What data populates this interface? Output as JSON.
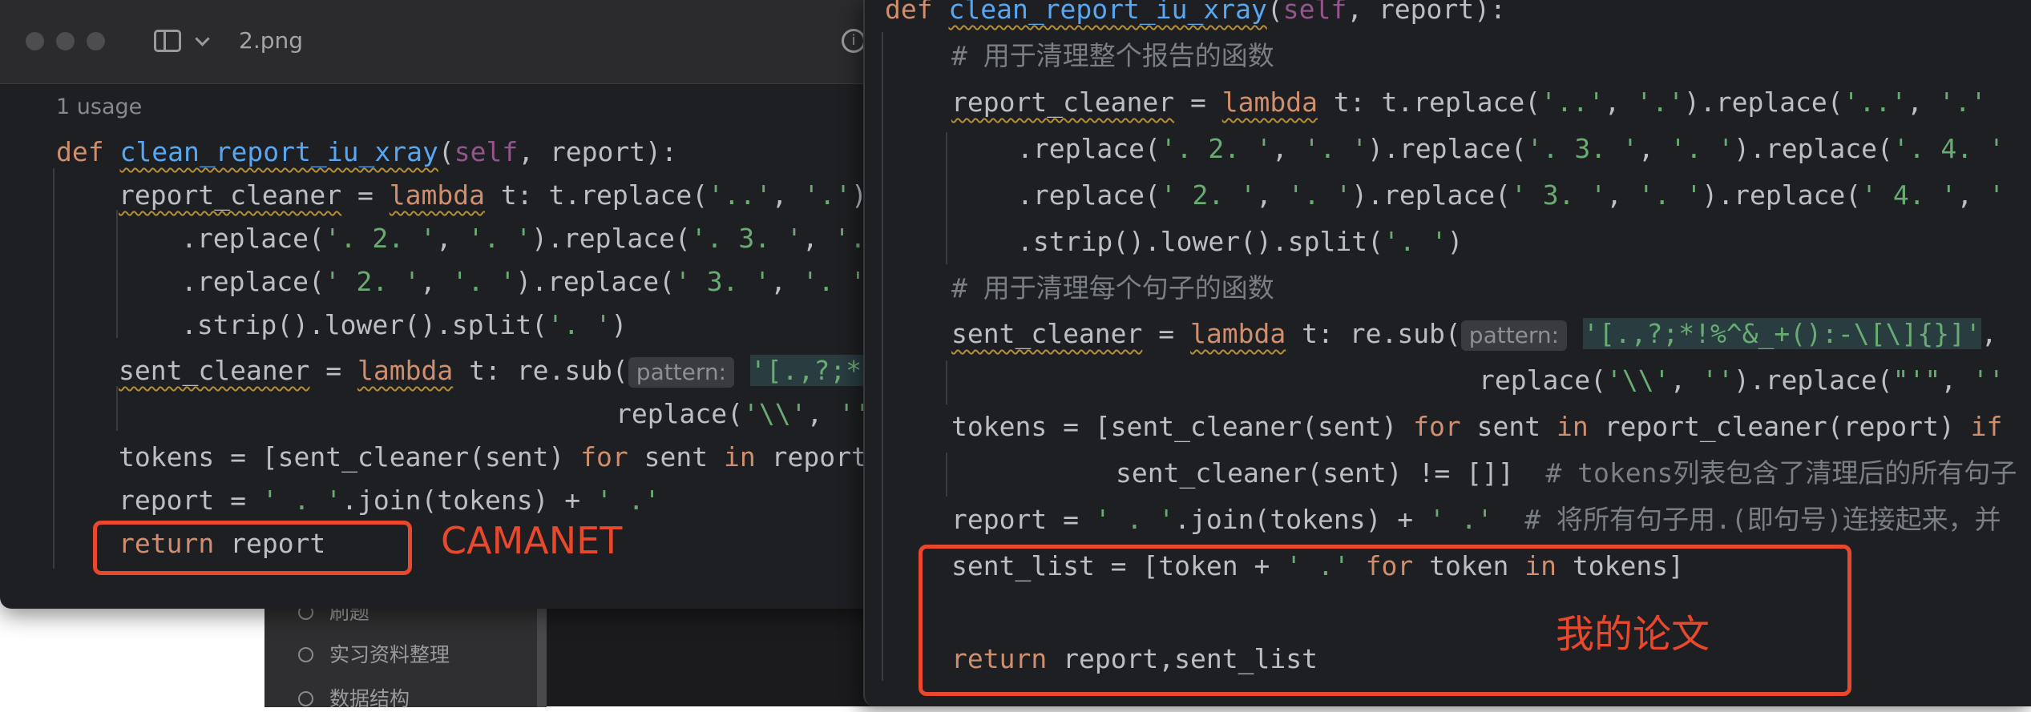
{
  "background_app": {
    "sidebar_items": [
      "刷题",
      "实习资料整理",
      "数据结构"
    ]
  },
  "left_window": {
    "title": "2.png",
    "usage": "1 usage",
    "code": {
      "def_kw": "def",
      "func_name": "clean_report_iu_xray",
      "paren_open": "(",
      "self_kw": "self",
      "sig_rest": ", report):",
      "l2_var": "report_cleaner",
      "l2_eq": " = ",
      "l2_lambda": "lambda",
      "l2_rest1": " t: t.replace(",
      "l2_s1": "'..'",
      "l2_comma": ", ",
      "l2_s2": "'.'",
      "l2_tail": ").",
      "l3_a": ".replace(",
      "l3_s1": "'. 2. '",
      "l3_c": ", ",
      "l3_s2": "'. '",
      "l3_b": ").replace(",
      "l3_s3": "'. 3. '",
      "l3_c2": ", ",
      "l3_s4": "'.",
      "l4_a": ".replace(",
      "l4_s1": "' 2. '",
      "l4_c": ", ",
      "l4_s2": "'. '",
      "l4_b": ").replace(",
      "l4_s3": "' 3. '",
      "l4_c2": ", ",
      "l4_s4": "'. ')",
      "l5_a": ".strip().lower().split(",
      "l5_s1": "'. '",
      "l5_b": ")",
      "l6_var": "sent_cleaner",
      "l6_eq": " = ",
      "l6_lambda": "lambda",
      "l6_rest": " t: re.sub(",
      "l6_hint": "pattern:",
      "l6_s1": "'[.,?;*!",
      "l7_a": "replace(",
      "l7_s1": "'\\\\'",
      "l7_c": ", ",
      "l7_s2": "''",
      "l8_a": "tokens = [sent_cleaner(sent) ",
      "l8_for": "for",
      "l8_b": " sent ",
      "l8_in": "in",
      "l8_c": " report_",
      "l9_a": "report = ",
      "l9_s1": "' . '",
      "l9_b": ".join(tokens) + ",
      "l9_s2": "' .'",
      "l10_ret": "return",
      "l10_rest": " report"
    },
    "label": "CAMANET"
  },
  "right_window": {
    "code": {
      "def_kw": "def",
      "func_name": "clean_report_iu_xray",
      "paren_open": "(",
      "self_kw": "self",
      "sig_rest": ", report):",
      "c1": "# 用于清理整个报告的函数",
      "l2_var": "report_cleaner",
      "l2_eq": " = ",
      "l2_lambda": "lambda",
      "l2_rest1": " t: t.replace(",
      "l2_s1": "'..'",
      "l2_c": ", ",
      "l2_s2": "'.'",
      "l2_b": ").replace(",
      "l2_s3": "'..'",
      "l2_c2": ", ",
      "l2_s4": "'.'",
      "l3_a": ".replace(",
      "l3_s1": "'. 2. '",
      "l3_c": ", ",
      "l3_s2": "'. '",
      "l3_b": ").replace(",
      "l3_s3": "'. 3. '",
      "l3_c2": ", ",
      "l3_s4": "'. '",
      "l3_d": ").replace(",
      "l3_s5": "'. 4. '",
      "l4_a": ".replace(",
      "l4_s1": "' 2. '",
      "l4_c": ", ",
      "l4_s2": "'. '",
      "l4_b": ").replace(",
      "l4_s3": "' 3. '",
      "l4_c2": ", ",
      "l4_s4": "'. '",
      "l4_d": ").replace(",
      "l4_s5": "' 4. '",
      "l4_c3": ", ",
      "l4_s6": "'",
      "l5_a": ".strip().lower().split(",
      "l5_s1": "'. '",
      "l5_b": ")",
      "c2": "# 用于清理每个句子的函数",
      "l6_var": "sent_cleaner",
      "l6_eq": " = ",
      "l6_lambda": "lambda",
      "l6_rest": " t: re.sub(",
      "l6_hint": "pattern:",
      "l6_s1": "'[.,?;*!%^&_+():-\\[\\]{}]'",
      "l6_tail": ",",
      "l7_a": "replace(",
      "l7_s1": "'\\\\'",
      "l7_c": ", ",
      "l7_s2": "''",
      "l7_b": ").replace(",
      "l7_s3": "\"'\"",
      "l7_c2": ", ",
      "l7_s4": "''",
      "l8_a": "tokens = [sent_cleaner(sent) ",
      "l8_for": "for",
      "l8_b": " sent ",
      "l8_in": "in",
      "l8_c": " report_cleaner(report) ",
      "l8_if": "if",
      "l9_a": "sent_cleaner(sent) != []]  ",
      "l9_cmt": "# tokens列表包含了清理后的所有句子",
      "l10_a": "report = ",
      "l10_s1": "' . '",
      "l10_b": ".join(tokens) + ",
      "l10_s2": "' .'",
      "l10_cmt": "  # 将所有句子用.(即句号)连接起来，并",
      "l11_a": "sent_list = [token + ",
      "l11_s1": "' .'",
      "l11_sp": " ",
      "l11_for": "for",
      "l11_b": " token ",
      "l11_in": "in",
      "l11_c": " tokens]",
      "l12_ret": "return",
      "l12_rest": " report,sent_list"
    },
    "label": "我的论文"
  },
  "colors": {
    "keyword": "#cf8e6d",
    "function": "#56a8f5",
    "string": "#6aab73",
    "comment": "#7a7e85",
    "highlight_box": "#e8482b"
  }
}
